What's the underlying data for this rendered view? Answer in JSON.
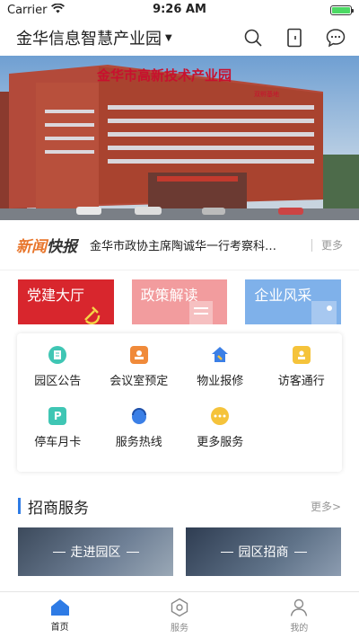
{
  "status": {
    "carrier": "Carrier",
    "time": "9:26 AM",
    "battery_level": 1.0
  },
  "header": {
    "title": "金华信息智慧产业园",
    "icons": [
      "search-icon",
      "door-icon",
      "message-icon"
    ]
  },
  "banner": {
    "building_sign": "金华市高新技术产业园",
    "sign_suffix": "双孵基地"
  },
  "news": {
    "tag_orange": "新闻",
    "tag_dark": "快报",
    "headline": "金华市政协主席陶诚华一行考察科…",
    "more": "更多"
  },
  "categories": [
    {
      "label": "党建大厅"
    },
    {
      "label": "政策解读"
    },
    {
      "label": "企业风采"
    }
  ],
  "services": [
    {
      "label": "园区公告",
      "icon": "notice-icon",
      "color": "#3fc6b4"
    },
    {
      "label": "会议室预定",
      "icon": "meeting-icon",
      "color": "#f08a3a"
    },
    {
      "label": "物业报修",
      "icon": "repair-icon",
      "color": "#3b7fe6"
    },
    {
      "label": "访客通行",
      "icon": "visitor-icon",
      "color": "#f5c33b"
    },
    {
      "label": "停车月卡",
      "icon": "parking-icon",
      "color": "#3fc6b4"
    },
    {
      "label": "服务热线",
      "icon": "hotline-icon",
      "color": "#3b7fe6"
    },
    {
      "label": "更多服务",
      "icon": "more-services-icon",
      "color": "#f5c33b"
    }
  ],
  "invest_section": {
    "title": "招商服务",
    "more": "更多>"
  },
  "invest_cards": [
    {
      "label": "走进园区"
    },
    {
      "label": "园区招商"
    }
  ],
  "tabs": [
    {
      "label": "首页",
      "icon": "home-icon",
      "active": true
    },
    {
      "label": "服务",
      "icon": "hexagon-icon",
      "active": false
    },
    {
      "label": "我的",
      "icon": "user-icon",
      "active": false
    }
  ],
  "colors": {
    "accent": "#2e7be5",
    "news_tag": "#e8762c",
    "party": "#d8262d",
    "policy": "#f29c9e",
    "enterprise": "#7fb1ea"
  }
}
